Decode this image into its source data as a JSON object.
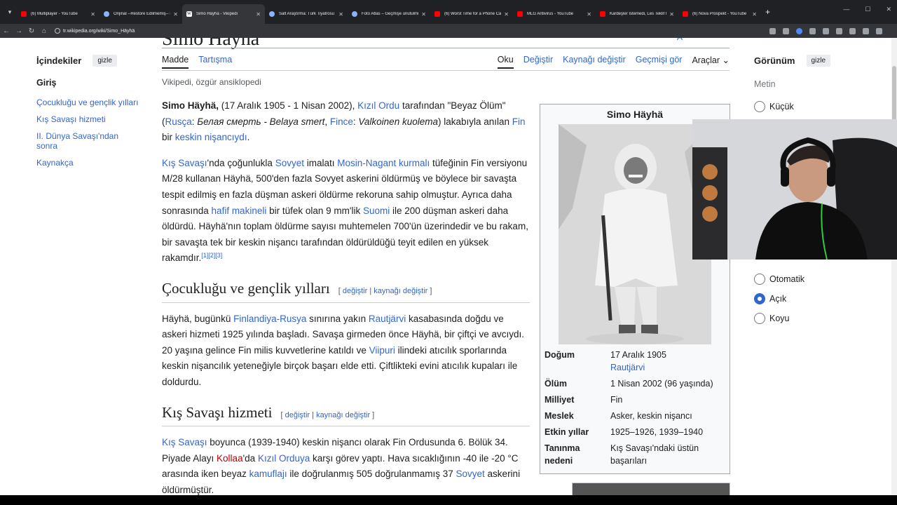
{
  "browser": {
    "tabs": [
      {
        "title": "(6) Multiplayer - YouTube",
        "fav": "yt",
        "active": false
      },
      {
        "title": "Orijinal --Restore Edilmemiş-- Fot",
        "fav": "gen",
        "active": false
      },
      {
        "title": "Simo Häyhä - Vikipedi",
        "fav": "wiki",
        "active": true
      },
      {
        "title": "Salt Araştırma: Türk Tiyatrosu",
        "fav": "gen",
        "active": false
      },
      {
        "title": "Foto Atlas – Geçmişe unutulmuş...",
        "fav": "gen",
        "active": false
      },
      {
        "title": "(6) Worst Time for a Phone Call",
        "fav": "yt",
        "active": false
      },
      {
        "title": "MLG Antivirus - YouTube",
        "fav": "yt",
        "active": false
      },
      {
        "title": "Kardeşler İstemedi, Les Teklif İle",
        "fav": "yt",
        "active": false
      },
      {
        "title": "(6) Nova Prospekt - YouTube",
        "fav": "yt",
        "active": false
      }
    ],
    "url": "tr.wikipedia.org/wiki/Simo_Häyhä",
    "icons": {
      "back": "back-arrow-icon",
      "forward": "forward-arrow-icon",
      "reload": "reload-icon",
      "home": "home-icon"
    }
  },
  "toc": {
    "title": "İçindekiler",
    "hide_label": "gizle",
    "items": [
      "Giriş",
      "Çocukluğu ve gençlik yılları",
      "Kış Savaşı hizmeti",
      "II. Dünya Savaşı'ndan sonra",
      "Kaynakça"
    ]
  },
  "article": {
    "title": "Simo Häyhä",
    "tabs_left": [
      "Madde",
      "Tartışma"
    ],
    "tabs_right": [
      "Oku",
      "Değiştir",
      "Kaynağı değiştir",
      "Geçmişi gör",
      "Araçlar"
    ],
    "tagline": "Vikipedi, özgür ansiklopedi",
    "p1": {
      "bold": "Simo Häyhä,",
      "t1": " (17 Aralık 1905 - 1 Nisan 2002), ",
      "l1": "Kızıl Ordu",
      "t2": " tarafından \"Beyaz Ölüm\" (",
      "l2": "Rusça",
      "t3": ": ",
      "i1": "Белая смерть - Belaya smert",
      "t4": ", ",
      "l3": "Fince",
      "t5": ": ",
      "i2": "Valkoinen kuolema",
      "t6": ") lakabıyla anılan ",
      "l4": "Fin",
      "t7": " bir ",
      "l5": "keskin nişancıydı",
      "t8": "."
    },
    "p2": {
      "l1": "Kış Savaşı",
      "t1": "'nda çoğunlukla ",
      "l2": "Sovyet",
      "t2": " imalatı ",
      "l3": "Mosin-Nagant kurmalı",
      "t3": " tüfeğinin Fin versiyonu M/28 kullanan Häyhä, 500'den fazla Sovyet askerini öldürmüş ve böylece bir savaşta tespit edilmiş en fazla düşman askeri öldürme rekoruna sahip olmuştur. Ayrıca daha sonrasında ",
      "l4": "hafif makineli",
      "t4": " bir tüfek olan 9 mm'lik ",
      "l5": "Suomi",
      "t5": " ile 200 düşman askeri daha öldürdü. Häyhä'nın toplam öldürme sayısı muhtemelen 700'ün üzerindedir ve bu rakam, bir savaşta tek bir keskin nişancı tarafından öldürüldüğü teyit edilen en yüksek rakamdır.",
      "refs": "[1][2][3]"
    },
    "sec1": {
      "title": "Çocukluğu ve gençlik yılları",
      "edit1": "değiştir",
      "edit2": "kaynağı değiştir"
    },
    "p3": {
      "t1": "Häyhä, bugünkü ",
      "l1": "Finlandiya-Rusya",
      "t2": " sınırına yakın ",
      "l2": "Rautjärvi",
      "t3": " kasabasında doğdu ve askeri hizmeti 1925 yılında başladı. Savaşa girmeden önce Häyhä, bir çiftçi ve avcıydı. 20 yaşına gelince Fin milis kuvvetlerine katıldı ve ",
      "l3": "Viipuri",
      "t4": " ilindeki atıcılık sporlarında keskin nişancılık yeteneğiyle birçok başarı elde etti. Çiftlikteki evini atıcılık kupaları ile doldurdu."
    },
    "sec2": {
      "title": "Kış Savaşı hizmeti",
      "edit1": "değiştir",
      "edit2": "kaynağı değiştir"
    },
    "p4": {
      "l1": "Kış Savaşı",
      "t1": " boyunca (1939-1940) keskin nişancı olarak Fin Ordusunda 6. Bölük 34. Piyade Alayı ",
      "l2": "Kollaa",
      "t2": "'da ",
      "l3": "Kızıl Orduya",
      "t3": " karşı görev yaptı. Hava sıcaklığının -40 ile -20 °C arasında iken beyaz ",
      "l4": "kamuflajı",
      "t4": " ile doğrulanmış 505 doğrulanmamış 37 ",
      "l5": "Sovyet",
      "t5": " askerini öldürmüştür."
    }
  },
  "infobox": {
    "title": "Simo Häyhä",
    "rows": [
      {
        "k": "Doğum",
        "v": "17 Aralık 1905",
        "link": "Rautjärvi"
      },
      {
        "k": "Ölüm",
        "v": "1 Nisan 2002 (96 yaşında)"
      },
      {
        "k": "Milliyet",
        "v": "Fin"
      },
      {
        "k": "Meslek",
        "v": "Asker, keskin nişancı"
      },
      {
        "k": "Etkin yıllar",
        "v": "1925–1926, 1939–1940"
      },
      {
        "k": "Tanınma nedeni",
        "v": "Kış Savaşı'ndaki üstün başarıları"
      }
    ]
  },
  "appearance": {
    "title": "Görünüm",
    "hide_label": "gizle",
    "sub": "Metin",
    "size_option": "Küçük",
    "theme_options": [
      "Otomatik",
      "Açık",
      "Koyu"
    ],
    "theme_selected": "Açık"
  },
  "colors": {
    "link": "#3366cc",
    "redlink": "#ba0000",
    "text": "#202122"
  }
}
